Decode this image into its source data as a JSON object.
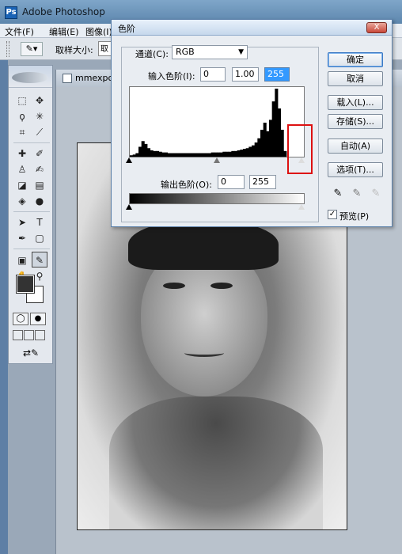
{
  "app": {
    "title": "Adobe Photoshop",
    "icon_name": "photoshop-app-icon"
  },
  "menu": {
    "items": [
      "文件(F)",
      "编辑(E)",
      "图像(I)"
    ]
  },
  "options_bar": {
    "tool_icon": "eyedropper-icon",
    "sample_size_label": "取样大小:",
    "sample_value": "取"
  },
  "document": {
    "tab_title": "mmexpor"
  },
  "dialog": {
    "title": "色阶",
    "close_label": "X",
    "channel_label": "通道(C):",
    "channel_value": "RGB",
    "input_levels_label": "输入色阶(I):",
    "input_black": "0",
    "input_gamma": "1.00",
    "input_white": "255",
    "output_levels_label": "输出色阶(O):",
    "output_black": "0",
    "output_white": "255",
    "buttons": {
      "ok": "确定",
      "cancel": "取消",
      "load": "载入(L)...",
      "save": "存储(S)...",
      "auto": "自动(A)",
      "options": "选项(T)..."
    },
    "preview_label": "预览(P)",
    "preview_checked": true,
    "histogram": [
      2,
      3,
      5,
      14,
      22,
      18,
      12,
      9,
      8,
      8,
      7,
      6,
      6,
      5,
      5,
      5,
      5,
      5,
      5,
      5,
      5,
      5,
      5,
      5,
      5,
      5,
      5,
      5,
      6,
      6,
      6,
      6,
      7,
      7,
      7,
      8,
      8,
      9,
      10,
      11,
      12,
      14,
      16,
      20,
      26,
      38,
      48,
      36,
      52,
      78,
      96,
      68,
      38,
      8,
      0,
      0,
      0,
      0,
      0,
      0
    ]
  },
  "colors": {
    "dialog_bg": "#e9edf2",
    "selection": "#3399ff",
    "highlight_box": "#dd1111",
    "foreground_swatch": "#333333",
    "background_swatch": "#ffffff"
  }
}
